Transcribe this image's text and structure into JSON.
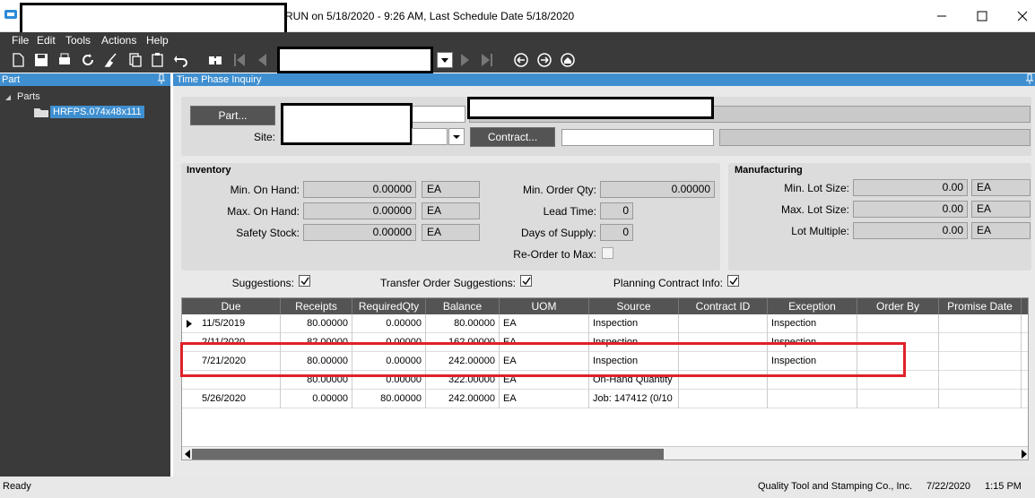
{
  "window": {
    "title": "RUN on 5/18/2020 - 9:26 AM, Last Schedule Date  5/18/2020"
  },
  "menu": [
    "File",
    "Edit",
    "Tools",
    "Actions",
    "Help"
  ],
  "left": {
    "header": "Part",
    "pin": "⮏",
    "tree_root": "Parts",
    "tree_item": "HRFPS.074x48x111"
  },
  "main": {
    "header": "Time Phase Inquiry",
    "part_button": "Part...",
    "site_label": "Site:",
    "contract_button": "Contract...",
    "inventory": {
      "title": "Inventory",
      "min_on_hand_label": "Min. On Hand:",
      "min_on_hand": "0.00000",
      "min_on_hand_uom": "EA",
      "max_on_hand_label": "Max. On Hand:",
      "max_on_hand": "0.00000",
      "max_on_hand_uom": "EA",
      "safety_stock_label": "Safety Stock:",
      "safety_stock": "0.00000",
      "safety_stock_uom": "EA",
      "min_order_qty_label": "Min. Order Qty:",
      "min_order_qty": "0.00000",
      "lead_time_label": "Lead Time:",
      "lead_time": "0",
      "days_of_supply_label": "Days of Supply:",
      "days_of_supply": "0",
      "reorder_label": "Re-Order to Max:"
    },
    "manufacturing": {
      "title": "Manufacturing",
      "min_lot_label": "Min. Lot Size:",
      "min_lot": "0.00",
      "min_lot_uom": "EA",
      "max_lot_label": "Max. Lot Size:",
      "max_lot": "0.00",
      "max_lot_uom": "EA",
      "lot_multiple_label": "Lot Multiple:",
      "lot_multiple": "0.00",
      "lot_multiple_uom": "EA"
    },
    "options": {
      "suggestions": "Suggestions:",
      "transfer": "Transfer Order Suggestions:",
      "planning": "Planning Contract Info:"
    },
    "grid": {
      "columns": [
        "Due",
        "Receipts",
        "RequiredQty",
        "Balance",
        "UOM",
        "Source",
        "Contract ID",
        "Exception",
        "Order By",
        "Promise Date"
      ],
      "rows": [
        [
          "11/5/2019",
          "80.00000",
          "0.00000",
          "80.00000",
          "EA",
          "Inspection",
          "",
          "Inspection",
          "",
          ""
        ],
        [
          "2/11/2020",
          "82.00000",
          "0.00000",
          "162.00000",
          "EA",
          "Inspection",
          "",
          "Inspection",
          "",
          ""
        ],
        [
          "7/21/2020",
          "80.00000",
          "0.00000",
          "242.00000",
          "EA",
          "Inspection",
          "",
          "Inspection",
          "",
          ""
        ],
        [
          "",
          "80.00000",
          "0.00000",
          "322.00000",
          "EA",
          "On-Hand Quantity",
          "",
          "",
          "",
          ""
        ],
        [
          "5/26/2020",
          "0.00000",
          "80.00000",
          "242.00000",
          "EA",
          "Job: 147412 (0/10",
          "",
          "",
          "",
          ""
        ]
      ]
    }
  },
  "status": {
    "left": "Ready",
    "company": "Quality Tool and Stamping Co., Inc.",
    "date": "7/22/2020",
    "time": "1:15 PM"
  },
  "colors": {
    "accent": "#3f8fd0",
    "highlight": "#e0212a",
    "dark": "#3a3a3a"
  }
}
